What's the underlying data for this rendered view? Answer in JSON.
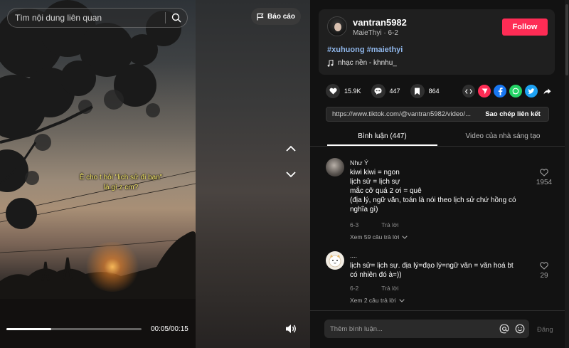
{
  "search": {
    "placeholder": "Tìm nội dung liên quan"
  },
  "report": {
    "label": "Báo cáo"
  },
  "video": {
    "caption_line1": "Ê cho t hỏi \"lịch sử đi bạn\"",
    "caption_line2": "là gì z cm?",
    "time": "00:05/00:15",
    "progress": 0.33
  },
  "author": {
    "username": "vantran5982",
    "display_name": "MaieThyi",
    "date": "6-2",
    "follow_label": "Follow",
    "hashtags": "#xuhuong #maiethyi",
    "music": "nhạc nền - khnhu_"
  },
  "stats": {
    "likes": "15.9K",
    "comments": "447",
    "saves": "864"
  },
  "share_icons": [
    "embed-icon",
    "send-icon",
    "facebook-icon",
    "whatsapp-icon",
    "twitter-icon",
    "share-arrow-icon"
  ],
  "colors": {
    "accent": "#fe2c55",
    "hashtag": "#8fb6ea",
    "caption": "#f6e86a"
  },
  "link": {
    "url": "https://www.tiktok.com/@vantran5982/video/...",
    "copy_label": "Sao chép liên kết"
  },
  "tabs": {
    "comments": "Bình luận (447)",
    "creator_videos": "Video của nhà sáng tạo"
  },
  "comments": [
    {
      "name": "Như Ý",
      "lines": [
        "kiwi kiwi = ngon",
        "lịch sử = lịch sự",
        "mắc cỡ quá 2 ơi = quê",
        "(địa lý, ngữ văn, toán là nói theo lịch sử chứ hồng có",
        "nghĩa gì)"
      ],
      "date": "6-3",
      "reply_label": "Trả lời",
      "view_replies": "Xem 59 câu trả lời",
      "likes": "1954"
    },
    {
      "name": "....",
      "lines": [
        "lịch sử= lịch sự. địa lý=đạo lý=ngữ văn = văn hoá bt",
        "có nhiên đó à=))"
      ],
      "date": "6-2",
      "reply_label": "Trả lời",
      "view_replies": "Xem 2 câu trả lời",
      "likes": "29"
    }
  ],
  "composer": {
    "placeholder": "Thêm bình luận...",
    "post_label": "Đăng"
  }
}
